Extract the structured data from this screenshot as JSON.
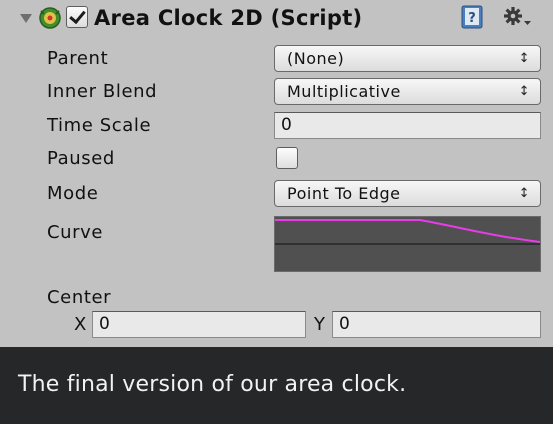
{
  "component": {
    "title": "Area Clock 2D (Script)",
    "enabled": true,
    "icon": "clock-script-icon",
    "help_icon": "help-book-icon",
    "settings_icon": "gear-dropdown-icon"
  },
  "fields": {
    "parent": {
      "label": "Parent",
      "value": "(None)"
    },
    "inner_blend": {
      "label": "Inner Blend",
      "value": "Multiplicative"
    },
    "time_scale": {
      "label": "Time Scale",
      "value": "0"
    },
    "paused": {
      "label": "Paused",
      "checked": false
    },
    "mode": {
      "label": "Mode",
      "value": "Point To Edge"
    },
    "curve": {
      "label": "Curve",
      "line_color": "#e83ce8"
    },
    "center": {
      "label": "Center",
      "x_label": "X",
      "x_value": "0",
      "y_label": "Y",
      "y_value": "0"
    }
  },
  "popup_arrows": "↕",
  "caption": "The final version of our area clock."
}
